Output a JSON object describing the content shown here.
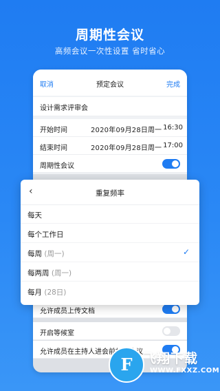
{
  "promo": {
    "title": "周期性会议",
    "subtitle": "高频会议一次性设置 省时省心"
  },
  "screen": {
    "cancel": "取消",
    "title": "预定会议",
    "done": "完成",
    "meeting_name": "设计需求评审会",
    "start": {
      "label": "开始时间",
      "date": "2020年09月28日",
      "weekday": "周一",
      "time": "16:30"
    },
    "end": {
      "label": "结束时间",
      "date": "2020年09月28日",
      "weekday": "周一",
      "time": "17:00"
    },
    "recurring": {
      "label": "周期性会议",
      "on": true
    },
    "allow_upload": {
      "label": "允许成员上传文档",
      "on": true
    },
    "waiting_room": {
      "label": "开启等候室",
      "on": false
    },
    "join_before_host": {
      "label": "允许成员在主持人进会前加入会议",
      "on": true
    }
  },
  "repeat_sheet": {
    "title": "重复频率",
    "back_icon": "chevron-left-icon",
    "options": [
      {
        "label": "每天",
        "hint": "",
        "selected": false
      },
      {
        "label": "每个工作日",
        "hint": "",
        "selected": false
      },
      {
        "label": "每周",
        "hint": "(周一)",
        "selected": true
      },
      {
        "label": "每两周",
        "hint": "(周一)",
        "selected": false
      },
      {
        "label": "每月",
        "hint": "(28日)",
        "selected": false
      }
    ],
    "check_icon": "checkmark-icon"
  },
  "watermark": {
    "brand": "飞翔下载",
    "url": "WWW.FXXZ.COM",
    "logo_letter": "F"
  },
  "colors": {
    "accent": "#1f7cf2",
    "background_top": "#1f7cf2",
    "background_bottom": "#3a96f7"
  }
}
